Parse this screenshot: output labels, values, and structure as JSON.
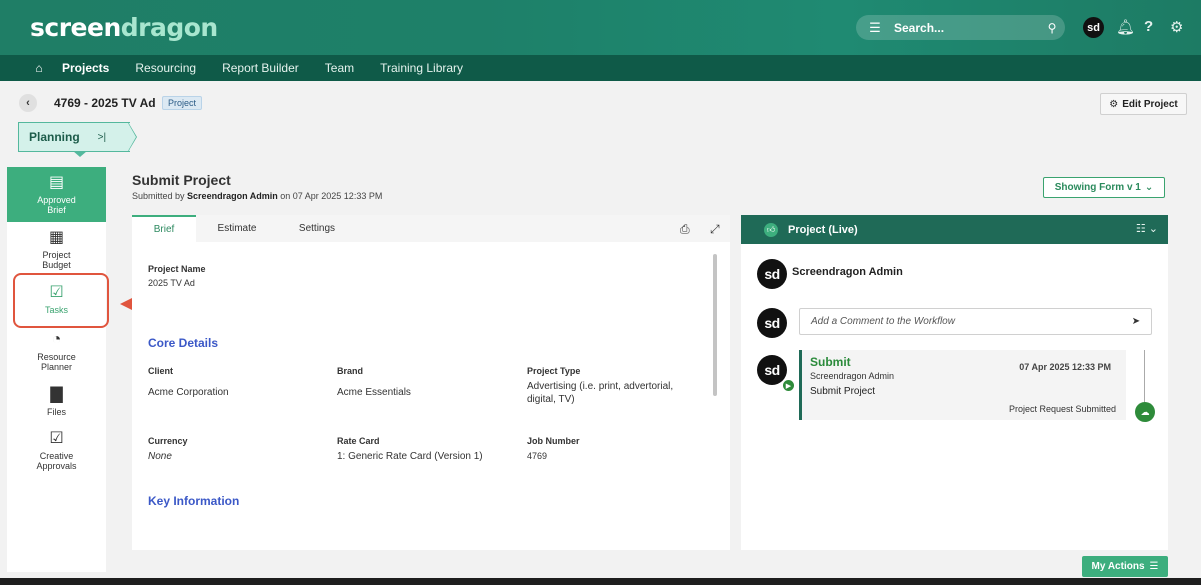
{
  "header": {
    "logo_part1": "screen",
    "logo_part2": "dragon",
    "search_placeholder": "Search...",
    "avatar_initials": "sd"
  },
  "nav": {
    "items": [
      "Projects",
      "Resourcing",
      "Report Builder",
      "Team",
      "Training Library"
    ],
    "active": "Projects"
  },
  "project": {
    "title": "4769 - 2025 TV Ad",
    "tag": "Project",
    "edit_label": "Edit Project",
    "stage": "Planning"
  },
  "sidebar": {
    "items": [
      {
        "label": "Approved Brief",
        "icon": "form-icon"
      },
      {
        "label": "Project Budget",
        "icon": "calculator-icon"
      },
      {
        "label": "Tasks",
        "icon": "calendar-check-icon"
      },
      {
        "label": "Resource Planner",
        "icon": "person-clock-icon"
      },
      {
        "label": "Files",
        "icon": "file-icon"
      },
      {
        "label": "Creative Approvals",
        "icon": "calendar-check-icon"
      }
    ]
  },
  "form": {
    "title": "Submit Project",
    "submitted_prefix": "Submitted by",
    "submitted_by": "Screendragon Admin",
    "submitted_suffix": "on 07 Apr 2025 12:33 PM",
    "showing_form": "Showing Form v 1",
    "tabs": [
      "Brief",
      "Estimate",
      "Settings"
    ],
    "project_name_label": "Project Name",
    "project_name_value": "2025 TV Ad",
    "core_details_heading": "Core Details",
    "client_label": "Client",
    "client_value": "Acme Corporation",
    "brand_label": "Brand",
    "brand_value": "Acme Essentials",
    "type_label": "Project Type",
    "type_value": "Advertising (i.e. print, advertorial, digital, TV)",
    "currency_label": "Currency",
    "currency_value": "None",
    "rate_card_label": "Rate Card",
    "rate_card_value": "1: Generic Rate Card (Version 1)",
    "job_number_label": "Job Number",
    "job_number_value": "4769",
    "key_info_heading": "Key Information"
  },
  "workflow": {
    "panel_title": "Project (Live)",
    "user_name": "Screendragon Admin",
    "comment_placeholder": "Add a Comment to the Workflow",
    "step_title": "Submit",
    "step_by": "Screendragon Admin",
    "step_action": "Submit Project",
    "step_date": "07 Apr 2025 12:33 PM",
    "step_status": "Project Request Submitted"
  },
  "footer": {
    "my_actions": "My Actions"
  },
  "colors": {
    "brand_green": "#1f7e66",
    "nav_dark": "#0f5a48",
    "accent": "#3dae7e",
    "heading_blue": "#3b58c7",
    "highlight_red": "#e0553e"
  }
}
